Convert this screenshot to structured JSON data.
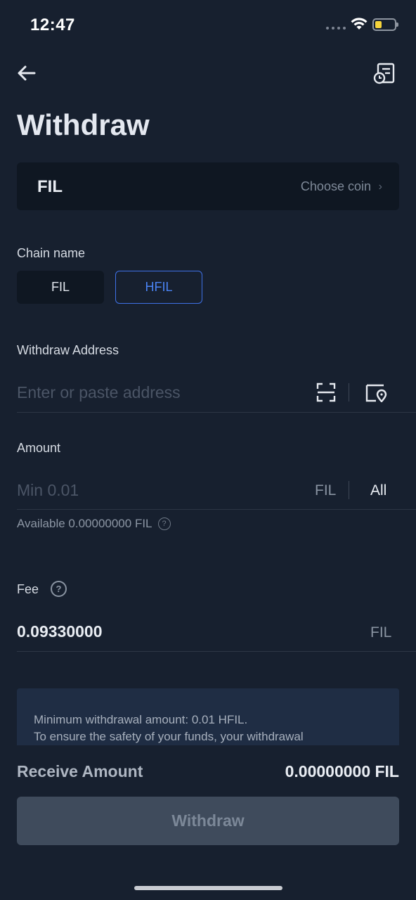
{
  "status_bar": {
    "time": "12:47"
  },
  "header": {
    "title": "Withdraw",
    "back_icon": "arrow-left-icon",
    "history_icon": "withdraw-history-icon"
  },
  "coin_selector": {
    "coin": "FIL",
    "choose_label": "Choose coin"
  },
  "chain": {
    "label": "Chain name",
    "options": [
      "FIL",
      "HFIL"
    ],
    "selected": "HFIL"
  },
  "address": {
    "label": "Withdraw Address",
    "placeholder": "Enter or paste address"
  },
  "amount": {
    "label": "Amount",
    "placeholder": "Min 0.01",
    "unit": "FIL",
    "all_label": "All",
    "available": "Available 0.00000000 FIL"
  },
  "fee": {
    "label": "Fee",
    "value": "0.09330000",
    "unit": "FIL"
  },
  "notice": {
    "line1": "Minimum withdrawal amount: 0.01 HFIL.",
    "line2": "To ensure the safety of your funds, your withdrawal"
  },
  "receive": {
    "label": "Receive Amount",
    "value": "0.00000000 FIL"
  },
  "submit": {
    "label": "Withdraw"
  },
  "colors": {
    "background": "#17202f",
    "accent": "#3f72e8",
    "button_disabled": "#3f4b5c"
  }
}
